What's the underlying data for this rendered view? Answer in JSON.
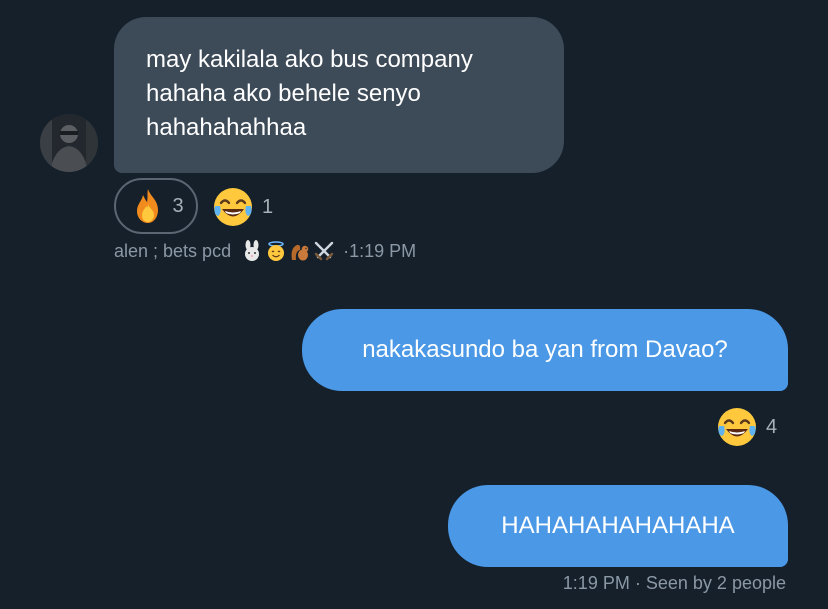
{
  "messages": [
    {
      "sender": "alen ; bets pcd",
      "text": "may kakilala ako bus company\nhahaha ako behele senyo\nhahahahahhaa",
      "time": "1:19 PM",
      "reactions": [
        {
          "icon": "fire-icon",
          "count": "3"
        },
        {
          "icon": "tears-of-joy-icon",
          "count": "1"
        }
      ],
      "name_emojis": [
        "rabbit-icon",
        "angel-icon",
        "squirrel-icon",
        "crossed-swords-icon"
      ]
    },
    {
      "text": "nakakasundo ba yan from Davao?",
      "reactions": [
        {
          "icon": "tears-of-joy-icon",
          "count": "4"
        }
      ]
    },
    {
      "text": "HAHAHAHAHAHAHA",
      "time": "1:19 PM",
      "seen": "Seen by 2 people"
    }
  ],
  "colors": {
    "background": "#15202b",
    "incoming_bubble": "#3d4a58",
    "outgoing_bubble": "#4a98e6",
    "meta_text": "#8b98a5"
  }
}
